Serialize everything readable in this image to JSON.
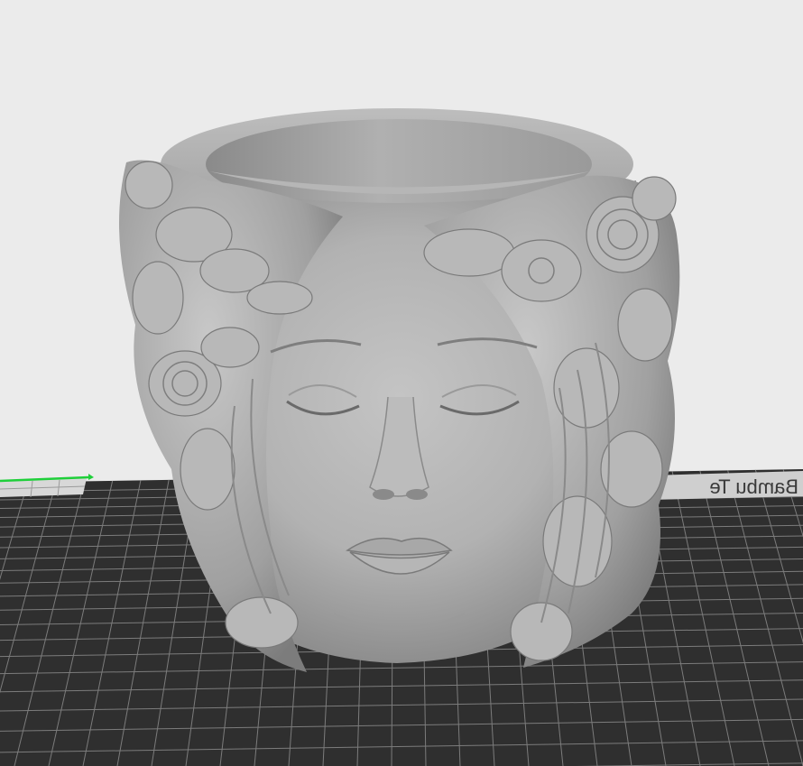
{
  "viewport": {
    "background_color": "#ebebeb",
    "plate": {
      "color": "#303030",
      "grid_color": "#7a7a7a",
      "label": "Bambu Te"
    },
    "axis": {
      "x_color": "#1fcf3a"
    },
    "model": {
      "name": "planter-face-icon",
      "color": "#a6a6a6"
    }
  }
}
